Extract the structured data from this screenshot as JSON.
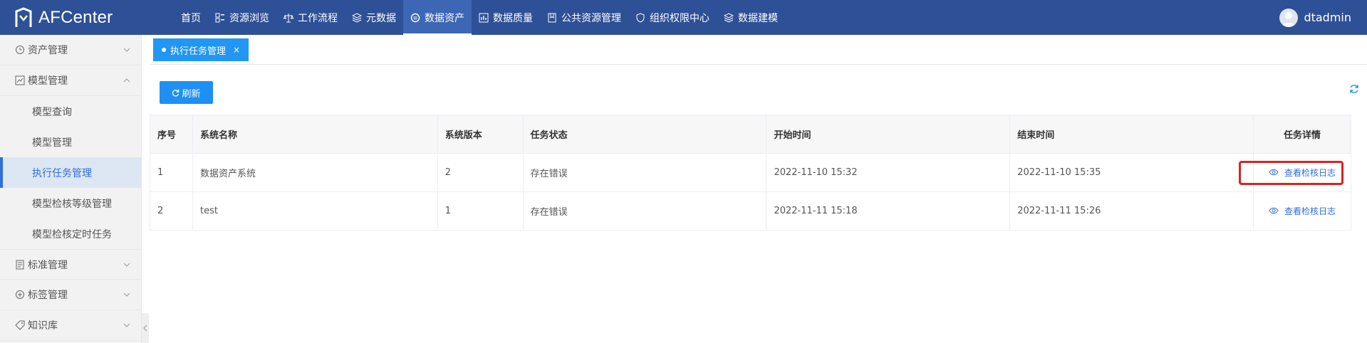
{
  "header": {
    "app_name": "AFCenter",
    "nav": [
      {
        "label": "首页",
        "icon": "",
        "active": false
      },
      {
        "label": "资源浏览",
        "icon": "grid-icon",
        "active": false
      },
      {
        "label": "工作流程",
        "icon": "scale-icon",
        "active": false
      },
      {
        "label": "元数据",
        "icon": "layers-icon",
        "active": false
      },
      {
        "label": "数据资产",
        "icon": "coin-icon",
        "active": true
      },
      {
        "label": "数据质量",
        "icon": "bar-chart-icon",
        "active": false
      },
      {
        "label": "公共资源管理",
        "icon": "book-icon",
        "active": false
      },
      {
        "label": "组织权限中心",
        "icon": "shield-icon",
        "active": false
      },
      {
        "label": "数据建模",
        "icon": "layers-icon",
        "active": false
      }
    ],
    "username": "dtadmin"
  },
  "sidebar": {
    "groups": [
      {
        "label": "资产管理",
        "icon": "clock-icon",
        "expanded": false
      },
      {
        "label": "模型管理",
        "icon": "chart-icon",
        "expanded": true,
        "items": [
          {
            "label": "模型查询",
            "active": false
          },
          {
            "label": "模型管理",
            "active": false
          },
          {
            "label": "执行任务管理",
            "active": true
          },
          {
            "label": "模型检核等级管理",
            "active": false
          },
          {
            "label": "模型检核定时任务",
            "active": false
          }
        ]
      },
      {
        "label": "标准管理",
        "icon": "document-icon",
        "expanded": false
      },
      {
        "label": "标签管理",
        "icon": "plus-circle-icon",
        "expanded": false
      },
      {
        "label": "知识库",
        "icon": "tag-icon",
        "expanded": false
      }
    ]
  },
  "tabs": [
    {
      "label": "执行任务管理",
      "close": "×"
    }
  ],
  "toolbar": {
    "refresh_label": "刷新"
  },
  "table": {
    "columns": [
      "序号",
      "系统名称",
      "系统版本",
      "任务状态",
      "开始时间",
      "结束时间",
      "任务详情"
    ],
    "rows": [
      {
        "index": "1",
        "system_name": "数据资产系统",
        "version": "2",
        "status": "存在错误",
        "start": "2022-11-10 15:32",
        "end": "2022-11-10 15:35",
        "detail": "查看检核日志"
      },
      {
        "index": "2",
        "system_name": "test",
        "version": "1",
        "status": "存在错误",
        "start": "2022-11-11 15:18",
        "end": "2022-11-11 15:26",
        "detail": "查看检核日志"
      }
    ]
  },
  "colors": {
    "header_bg": "#2e5096",
    "accent": "#1e90f3",
    "highlight": "#e02020"
  }
}
